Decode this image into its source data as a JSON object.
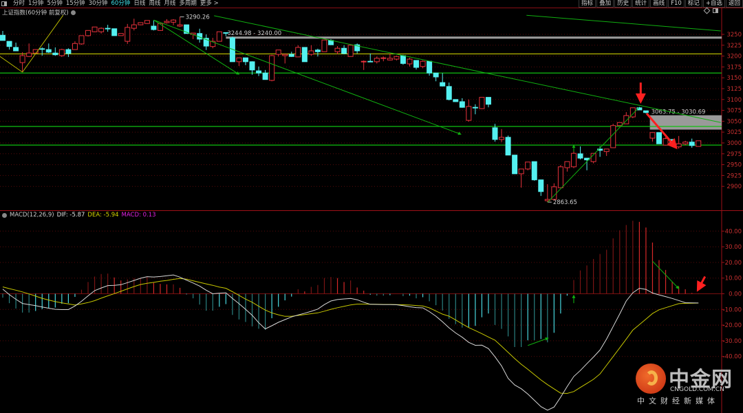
{
  "toolbar": {
    "tabs": [
      {
        "label": "分时",
        "active": false
      },
      {
        "label": "1分钟",
        "active": false
      },
      {
        "label": "5分钟",
        "active": false
      },
      {
        "label": "15分钟",
        "active": false
      },
      {
        "label": "30分钟",
        "active": false
      },
      {
        "label": "60分钟",
        "active": true
      },
      {
        "label": "日线",
        "active": false
      },
      {
        "label": "周线",
        "active": false
      },
      {
        "label": "月线",
        "active": false
      },
      {
        "label": "多周期",
        "active": false
      },
      {
        "label": "更多 >",
        "active": false
      }
    ],
    "right_buttons": [
      "指标",
      "叠加",
      "历史",
      "统计",
      "画线",
      "F10",
      "标记",
      "+自选",
      "返回"
    ]
  },
  "chart_title": "上证指数(60分钟 前复权)",
  "macd_label": {
    "name": "MACD(12,26,9)",
    "dif": "DIF: -5.87",
    "dea": "DEA: -5.94",
    "macd": "MACD: 0.13"
  },
  "colors": {
    "up": "#e8323c",
    "down": "#54f0f0",
    "dif": "#d8d8d8",
    "dea": "#c8c800",
    "macd_text": "#e020e0",
    "axis": "#c83030",
    "background": "#000000"
  },
  "logo": {
    "main": "中金网",
    "url": "CNGOLD.COM.CN",
    "sub": "中文财经新媒体"
  },
  "chart_data": [
    {
      "type": "candlestick",
      "title": "上证指数(60分钟 前复权)",
      "ylim": [
        2880,
        3270
      ],
      "yticks": [
        3250,
        3225,
        3200,
        3175,
        3150,
        3125,
        3100,
        3075,
        3050,
        3025,
        3000,
        2975,
        2950,
        2925,
        2900
      ],
      "grid": "dotted horizontal",
      "ohlc": [
        [
          3248,
          3258,
          3236,
          3236
        ],
        [
          3234,
          3234,
          3215,
          3222
        ],
        [
          3220,
          3231,
          3212,
          3212
        ],
        [
          3185,
          3209,
          3163,
          3201
        ],
        [
          3199,
          3229,
          3198,
          3207
        ],
        [
          3207,
          3215,
          3206,
          3215
        ],
        [
          3217,
          3220,
          3201,
          3216
        ],
        [
          3215,
          3229,
          3207,
          3209
        ],
        [
          3207,
          3220,
          3201,
          3203
        ],
        [
          3201,
          3217,
          3198,
          3215
        ],
        [
          3215,
          3218,
          3198,
          3206
        ],
        [
          3215,
          3234,
          3215,
          3229
        ],
        [
          3228,
          3247,
          3226,
          3247
        ],
        [
          3247,
          3259,
          3245,
          3259
        ],
        [
          3256,
          3267,
          3255,
          3267
        ],
        [
          3256,
          3266,
          3252,
          3264
        ],
        [
          3264,
          3272,
          3256,
          3263
        ],
        [
          3263,
          3263,
          3247,
          3247
        ],
        [
          3247,
          3252,
          3247,
          3252
        ],
        [
          3234,
          3274,
          3228,
          3266
        ],
        [
          3264,
          3286,
          3259,
          3272
        ],
        [
          3272,
          3277,
          3271,
          3277
        ],
        [
          3275,
          3282,
          3274,
          3282
        ],
        [
          3269,
          3282,
          3259,
          3261
        ],
        [
          3259,
          3275,
          3258,
          3275
        ],
        [
          3277,
          3285,
          3275,
          3280
        ],
        [
          3278,
          3285,
          3271,
          3283
        ],
        [
          3269,
          3290.26,
          3267,
          3272
        ],
        [
          3272,
          3272,
          3252,
          3252
        ],
        [
          3250,
          3253,
          3239,
          3253
        ],
        [
          3252,
          3263,
          3231,
          3239
        ],
        [
          3241,
          3250,
          3214,
          3223
        ],
        [
          3222,
          3242,
          3218,
          3234
        ],
        [
          3234,
          3256,
          3234,
          3256
        ],
        [
          3254,
          3255,
          3246,
          3253
        ],
        [
          3242,
          3244.98,
          3187,
          3187
        ],
        [
          3187,
          3196,
          3177,
          3196
        ],
        [
          3196,
          3196,
          3179,
          3187
        ],
        [
          3187,
          3188,
          3157,
          3168
        ],
        [
          3166,
          3176,
          3154,
          3161
        ],
        [
          3161,
          3168,
          3146,
          3146
        ],
        [
          3144,
          3203,
          3142,
          3201
        ],
        [
          3204,
          3214,
          3199,
          3214
        ],
        [
          3201,
          3204,
          3183,
          3204
        ],
        [
          3204,
          3210,
          3198,
          3199
        ],
        [
          3198,
          3225,
          3198,
          3220
        ],
        [
          3220,
          3220,
          3187,
          3187
        ],
        [
          3204,
          3225,
          3201,
          3212
        ],
        [
          3214,
          3217,
          3199,
          3210
        ],
        [
          3210,
          3237,
          3210,
          3237
        ],
        [
          3236,
          3239,
          3226,
          3226
        ],
        [
          3210,
          3223,
          3204,
          3218
        ],
        [
          3218,
          3225,
          3204,
          3206
        ],
        [
          3199,
          3225,
          3199,
          3225
        ],
        [
          3226,
          3229,
          3206,
          3212
        ],
        [
          3187,
          3190,
          3168,
          3188
        ],
        [
          3188,
          3206,
          3187,
          3187
        ],
        [
          3187,
          3199,
          3183,
          3195
        ],
        [
          3195,
          3199,
          3188,
          3196
        ],
        [
          3191,
          3206,
          3190,
          3195
        ],
        [
          3193,
          3201,
          3190,
          3199
        ],
        [
          3201,
          3203,
          3180,
          3183
        ],
        [
          3182,
          3196,
          3176,
          3193
        ],
        [
          3190,
          3190,
          3169,
          3174
        ],
        [
          3176,
          3190,
          3172,
          3188
        ],
        [
          3188,
          3188,
          3155,
          3161
        ],
        [
          3161,
          3161,
          3142,
          3152
        ],
        [
          3139,
          3161,
          3130,
          3131
        ],
        [
          3130,
          3139,
          3098,
          3100
        ],
        [
          3100,
          3100,
          3095,
          3095
        ],
        [
          3095,
          3103,
          3081,
          3082
        ],
        [
          3052,
          3100,
          3049,
          3084
        ],
        [
          3082,
          3089,
          3066,
          3081
        ],
        [
          3079,
          3105,
          3078,
          3105
        ],
        [
          3105,
          3105,
          3082,
          3089
        ],
        [
          3035,
          3044,
          3003,
          3008
        ],
        [
          3008,
          3032,
          3002,
          3013
        ],
        [
          3013,
          3017,
          2972,
          2972
        ],
        [
          2972,
          2972,
          2929,
          2929
        ],
        [
          2929,
          2940,
          2897,
          2940
        ],
        [
          2940,
          2956,
          2937,
          2956
        ],
        [
          2957,
          2957,
          2913,
          2915
        ],
        [
          2915,
          2915,
          2878,
          2888
        ],
        [
          2867,
          2905,
          2863.65,
          2870
        ],
        [
          2870,
          2907,
          2867,
          2899
        ],
        [
          2897,
          2949,
          2897,
          2945
        ],
        [
          2943,
          2957,
          2934,
          2957
        ],
        [
          2945,
          2994,
          2942,
          2976
        ],
        [
          2975,
          2992,
          2962,
          2965
        ],
        [
          2965,
          2965,
          2937,
          2961
        ],
        [
          2957,
          2976,
          2953,
          2976
        ],
        [
          2986,
          2992,
          2968,
          2983
        ],
        [
          2980,
          2986,
          2970,
          2986
        ],
        [
          2989,
          3044,
          2989,
          3040
        ],
        [
          3040,
          3047,
          3040,
          3047
        ],
        [
          3044,
          3071,
          3044,
          3063
        ],
        [
          3060,
          3081,
          3057,
          3081
        ],
        [
          3081,
          3083,
          3076,
          3076
        ],
        [
          3074,
          3074,
          3068,
          3070
        ],
        [
          3011,
          3024,
          3003,
          3024
        ],
        [
          3024,
          3024,
          2998,
          2998
        ],
        [
          2995,
          3013,
          2994,
          3010
        ],
        [
          3008,
          3008,
          3000,
          3000
        ],
        [
          2991,
          3016,
          2987,
          2998
        ],
        [
          2998,
          3005,
          2995,
          3002
        ],
        [
          3002,
          3010,
          2989,
          2994
        ],
        [
          2992,
          3005,
          2992,
          3005
        ]
      ],
      "horizontal_lines": [
        {
          "price": 3205,
          "color": "#c8c800"
        },
        {
          "price": 3161,
          "color": "#10c010"
        },
        {
          "price": 3038,
          "color": "#10c010"
        },
        {
          "price": 2995,
          "color": "#10c010"
        }
      ],
      "bands": [
        {
          "from_bar": 35,
          "top": 3244.98,
          "bottom": 3240.0,
          "label": "3244.98 - 3240.00"
        },
        {
          "from_bar": 99.6,
          "top": 3063.75,
          "bottom": 3030.69,
          "label": "3063.75 - 3030.69"
        }
      ],
      "price_labels": [
        {
          "bar": 28,
          "price": 3290.26,
          "label": "3290.26"
        },
        {
          "bar": 84,
          "price": 2863.65,
          "label": "2863.65"
        }
      ],
      "trendlines": [
        {
          "from": [
            0.6,
            3199
          ],
          "to": [
            4,
            3163
          ],
          "color": "#b8b800",
          "arrow": false
        },
        {
          "from": [
            4,
            3163
          ],
          "to": [
            10.2,
            3294
          ],
          "color": "#b8b800",
          "arrow": false
        },
        {
          "from": [
            24,
            3283
          ],
          "to": [
            37,
            3158
          ],
          "color": "#10b010",
          "arrow": true
        },
        {
          "from": [
            24,
            3283
          ],
          "to": [
            70.8,
            3020
          ],
          "color": "#10b010",
          "arrow": true
        },
        {
          "from": [
            33.2,
            3293
          ],
          "to": [
            110.4,
            3047
          ],
          "color": "#10b010",
          "arrow": false
        },
        {
          "from": [
            80.8,
            3294
          ],
          "to": [
            110.4,
            3258
          ],
          "color": "#10b010",
          "arrow": false
        },
        {
          "from": [
            84,
            2863
          ],
          "to": [
            97.9,
            3081
          ],
          "color": "#10b010",
          "arrow": false
        },
        {
          "from": [
            88,
            2980
          ],
          "to": [
            88,
            2995
          ],
          "color": "#10c010",
          "arrow": true
        },
        {
          "from": [
            98.2,
            3139
          ],
          "to": [
            98.2,
            3095
          ],
          "color": "#ff2020",
          "arrow": true,
          "thick": true
        },
        {
          "from": [
            99.1,
            3068
          ],
          "to": [
            103.6,
            2989
          ],
          "color": "#ff2020",
          "arrow": true,
          "thick": true
        }
      ]
    },
    {
      "type": "macd",
      "title": "MACD(12,26,9)",
      "ylim": [
        -76,
        48
      ],
      "yticks": [
        "40.00",
        "30.00",
        "20.00",
        "10.00",
        "0.00",
        "-10.00",
        "-20.00",
        "-30.00",
        "-40.00"
      ],
      "macd": [
        -2.5,
        -6,
        -9.4,
        -12,
        -12,
        -11,
        -9.8,
        -9,
        -8.8,
        -6.4,
        -6,
        -2,
        2.6,
        7.5,
        11,
        12.6,
        12.9,
        10.4,
        8.5,
        9.2,
        10,
        10,
        10.7,
        7,
        6.3,
        6,
        6,
        3.8,
        -0.4,
        -2.9,
        -6.9,
        -10.8,
        -10.8,
        -8.3,
        -6.6,
        -13.5,
        -16.4,
        -18,
        -20.8,
        -22.3,
        -23,
        -15.6,
        -8.3,
        -4.2,
        -1.8,
        2.9,
        1.5,
        4.4,
        5.6,
        10,
        10.7,
        10,
        7.5,
        8.5,
        4,
        2,
        -0.6,
        -1.2,
        -1.2,
        -0.9,
        0,
        -1.5,
        -1.2,
        -2.9,
        -2.2,
        -4.8,
        -7.3,
        -10.7,
        -16,
        -19.4,
        -21.6,
        -21.3,
        -20.5,
        -15,
        -12.6,
        -19.9,
        -22.4,
        -27.2,
        -34,
        -34,
        -29.7,
        -29.7,
        -28.9,
        -31,
        -24.9,
        -12.6,
        -1.2,
        8.8,
        14.9,
        18.1,
        22.2,
        25.4,
        28.1,
        35.4,
        40.5,
        43.9,
        46.6,
        45.9,
        42.3,
        32.7,
        21.5,
        15.2,
        7.9,
        4.7,
        2.9,
        0.5,
        0.13
      ],
      "dif": [
        3.0,
        -0.5,
        -3.5,
        -6.2,
        -6.9,
        -7.6,
        -8.4,
        -9.2,
        -9.9,
        -10.1,
        -10.1,
        -7.8,
        -4.8,
        -1.3,
        2.0,
        3.7,
        5.2,
        5.4,
        5.8,
        7.1,
        8.5,
        9.9,
        10.9,
        10.7,
        11.0,
        11.5,
        12.0,
        10.6,
        8.7,
        6.9,
        4.9,
        2.3,
        0,
        0.4,
        0.6,
        -3.0,
        -6.3,
        -9.9,
        -13.7,
        -18.5,
        -22.4,
        -20.4,
        -18.2,
        -16.5,
        -14.8,
        -13.5,
        -12.4,
        -11.2,
        -9.8,
        -6.9,
        -4.6,
        -3.7,
        -3.3,
        -3.0,
        -3.8,
        -5.4,
        -6.7,
        -6.8,
        -6.9,
        -6.9,
        -7.0,
        -7.6,
        -8.3,
        -8.8,
        -9.0,
        -11.4,
        -14.3,
        -17.9,
        -21.7,
        -25,
        -27.7,
        -31,
        -32.9,
        -32.8,
        -35,
        -40.2,
        -46,
        -54,
        -58.2,
        -60.6,
        -64,
        -68,
        -72,
        -74.3,
        -72.3,
        -66,
        -59.2,
        -52.8,
        -49,
        -44.6,
        -40.4,
        -35.9,
        -28.9,
        -20.9,
        -12.9,
        -4.6,
        0.6,
        3.5,
        2.8,
        0.5,
        -0.7,
        -1.8,
        -3.0,
        -4.3,
        -5.7,
        -5.8,
        -5.87
      ],
      "dea": [
        4.4,
        3.3,
        2.3,
        1.2,
        -0.1,
        -1.5,
        -2.9,
        -4.0,
        -5.0,
        -5.8,
        -6.5,
        -7.2,
        -6.5,
        -5.6,
        -4.4,
        -2.8,
        -1.3,
        0.1,
        1.6,
        3.1,
        4.6,
        5.9,
        6.7,
        7.3,
        8.0,
        8.5,
        9.2,
        9.8,
        9.3,
        8.3,
        7.3,
        6.3,
        5.4,
        4.3,
        3.5,
        1.3,
        -1.0,
        -3.4,
        -5.4,
        -8.0,
        -10.4,
        -12.2,
        -13.4,
        -14.4,
        -14.4,
        -13.8,
        -13.3,
        -12.7,
        -12.2,
        -11.1,
        -9.9,
        -8.9,
        -8.0,
        -7.1,
        -6.6,
        -6.6,
        -6.7,
        -6.7,
        -6.8,
        -6.8,
        -6.9,
        -7.0,
        -7.2,
        -7.5,
        -7.8,
        -9.0,
        -11.0,
        -13.0,
        -14.3,
        -16.7,
        -19.2,
        -21.6,
        -23.5,
        -25.5,
        -27.6,
        -29.6,
        -33.4,
        -37.4,
        -41.3,
        -45,
        -48.2,
        -51.6,
        -55,
        -58,
        -60.7,
        -63.4,
        -63.6,
        -62.4,
        -59.8,
        -57.2,
        -54.6,
        -51.2,
        -45.6,
        -40.1,
        -34.5,
        -28.9,
        -23.2,
        -19.7,
        -16.2,
        -12.6,
        -10.2,
        -8.9,
        -7.6,
        -6.3,
        -6.1,
        -6.0,
        -5.94
      ],
      "annotations": [
        {
          "from": [
            81,
            -33
          ],
          "to": [
            84.1,
            -28.3
          ],
          "color": "#10b010",
          "arrow": true
        },
        {
          "from": [
            100,
            20.8
          ],
          "to": [
            104,
            3.3
          ],
          "color": "#10b010",
          "arrow": true
        },
        {
          "from": [
            88,
            -6
          ],
          "to": [
            88,
            -1
          ],
          "color": "#10c010",
          "arrow": true
        },
        {
          "from": [
            108,
            11
          ],
          "to": [
            106.9,
            2.4
          ],
          "color": "#ff2020",
          "arrow": true,
          "thick": true
        }
      ]
    }
  ]
}
